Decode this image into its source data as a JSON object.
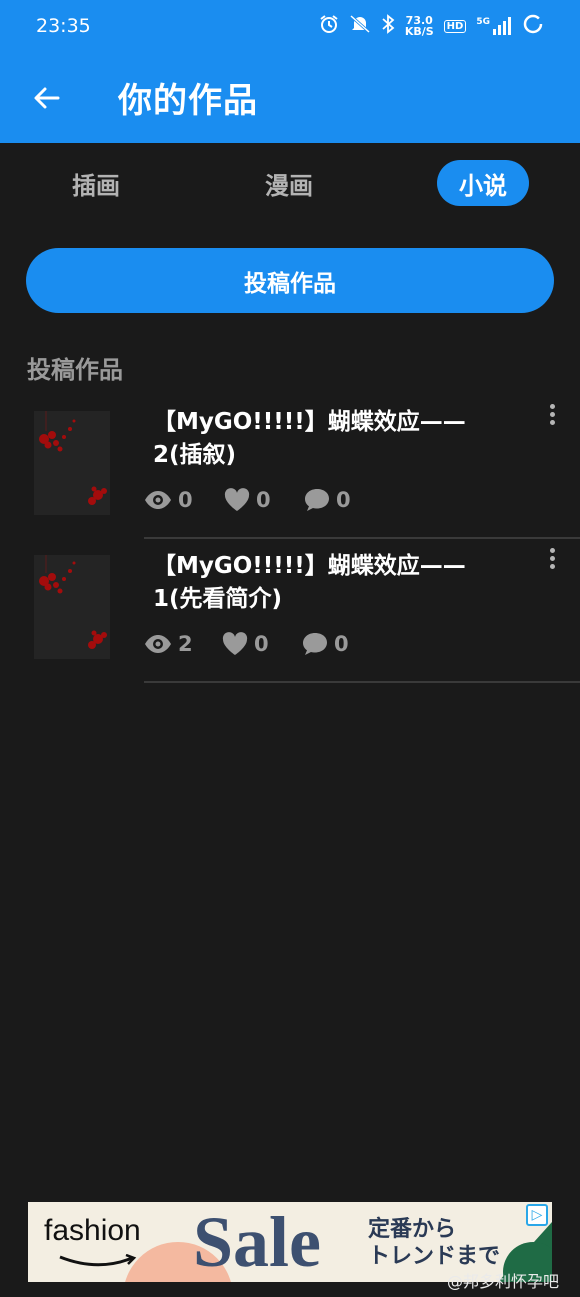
{
  "status": {
    "time": "23:35",
    "net_speed_value": "73.0",
    "net_speed_unit": "KB/S",
    "hd_label": "HD",
    "network_label": "5G"
  },
  "appbar": {
    "title": "你的作品"
  },
  "tabs": [
    {
      "label": "插画"
    },
    {
      "label": "漫画"
    },
    {
      "label": "小说"
    }
  ],
  "submit_label": "投稿作品",
  "section_label": "投稿作品",
  "works": [
    {
      "title": "【MyGO!!!!!】蝴蝶效应——2(插叙)",
      "views": "0",
      "likes": "0",
      "comments": "0"
    },
    {
      "title": "【MyGO!!!!!】蝴蝶效应——1(先看简介)",
      "views": "2",
      "likes": "0",
      "comments": "0"
    }
  ],
  "ad": {
    "brand": "fashion",
    "headline": "Sale",
    "tagline_line1": "定番から",
    "tagline_line2": "トレンドまで"
  },
  "watermark": "@邦多利怀孕吧",
  "colors": {
    "accent": "#1a8df0",
    "background": "#1a1a1a"
  }
}
